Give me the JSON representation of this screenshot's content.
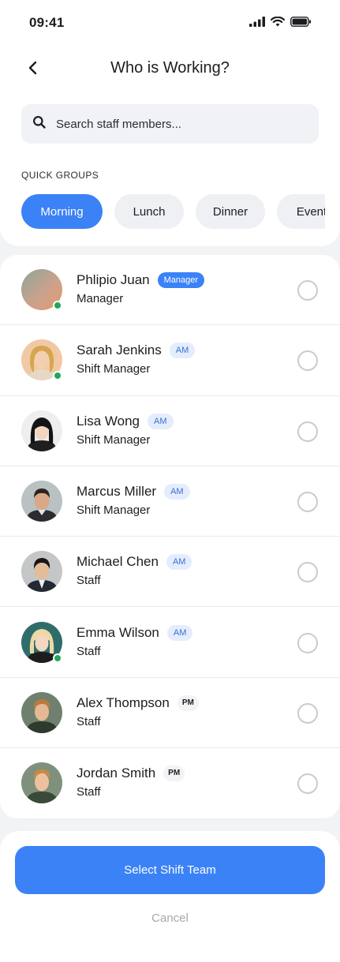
{
  "status_bar": {
    "time": "09:41"
  },
  "header": {
    "title": "Who is Working?",
    "back_icon": "chevron-left-icon"
  },
  "search": {
    "placeholder": "Search staff members...",
    "value": "",
    "icon": "search-icon"
  },
  "quick_groups": {
    "label": "QUICK GROUPS",
    "chips": [
      {
        "label": "Morning",
        "active": true
      },
      {
        "label": "Lunch",
        "active": false
      },
      {
        "label": "Dinner",
        "active": false
      },
      {
        "label": "Event",
        "active": false
      }
    ]
  },
  "staff": [
    {
      "name": "Phlipio Juan",
      "badge": "Manager",
      "badge_type": "manager",
      "role": "Manager",
      "online": true,
      "selected": false
    },
    {
      "name": "Sarah Jenkins",
      "badge": "AM",
      "badge_type": "am",
      "role": "Shift Manager",
      "online": true,
      "selected": false
    },
    {
      "name": "Lisa Wong",
      "badge": "AM",
      "badge_type": "am",
      "role": "Shift Manager",
      "online": false,
      "selected": false
    },
    {
      "name": "Marcus Miller",
      "badge": "AM",
      "badge_type": "am",
      "role": "Shift Manager",
      "online": false,
      "selected": false
    },
    {
      "name": "Michael Chen",
      "badge": "AM",
      "badge_type": "am",
      "role": "Staff",
      "online": false,
      "selected": false
    },
    {
      "name": "Emma Wilson",
      "badge": "AM",
      "badge_type": "am",
      "role": "Staff",
      "online": true,
      "selected": false
    },
    {
      "name": "Alex Thompson",
      "badge": "PM",
      "badge_type": "pm",
      "role": "Staff",
      "online": false,
      "selected": false
    },
    {
      "name": "Jordan Smith",
      "badge": "PM",
      "badge_type": "pm",
      "role": "Staff",
      "online": false,
      "selected": false
    }
  ],
  "actions": {
    "primary_label": "Select Shift Team",
    "cancel_label": "Cancel"
  },
  "colors": {
    "accent": "#3b82f6",
    "online": "#22a75a",
    "background": "#f2f3f5"
  }
}
